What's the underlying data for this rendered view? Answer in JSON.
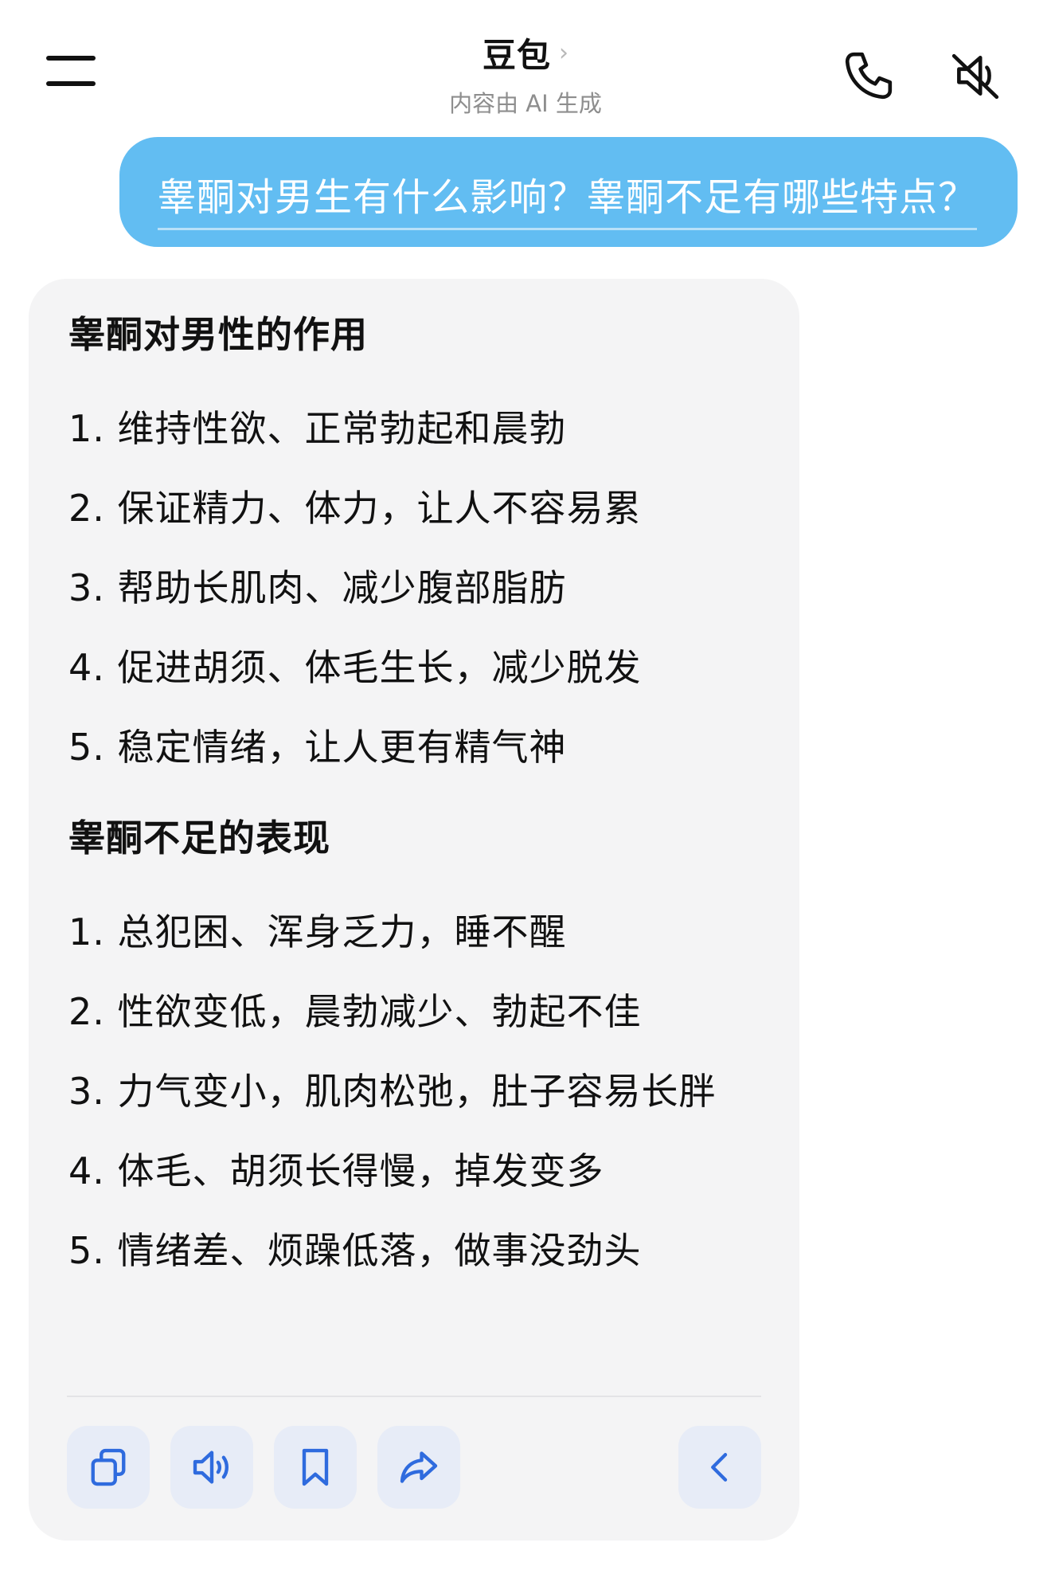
{
  "header": {
    "title": "豆包",
    "title_chevron": "›",
    "subtitle": "内容由 AI 生成"
  },
  "user_message": {
    "text": "睾酮对男生有什么影响？睾酮不足有哪些特点？"
  },
  "answer": {
    "section1": {
      "heading": "睾酮对男性的作用",
      "items": [
        "1. 维持性欲、正常勃起和晨勃",
        "2. 保证精力、体力，让人不容易累",
        "3. 帮助长肌肉、减少腹部脂肪",
        "4. 促进胡须、体毛生长，减少脱发",
        "5. 稳定情绪，让人更有精气神"
      ]
    },
    "section2": {
      "heading": "睾酮不足的表现",
      "items": [
        "1. 总犯困、浑身乏力，睡不醒",
        "2. 性欲变低，晨勃减少、勃起不佳",
        "3. 力气变小，肌肉松弛，肚子容易长胖",
        "4. 体毛、胡须长得慢，掉发变多",
        "5. 情绪差、烦躁低落，做事没劲头"
      ]
    }
  },
  "icons": {
    "menu": "menu-icon",
    "phone": "phone-icon",
    "mute": "speaker-mute-icon",
    "copy": "copy-icon",
    "read_aloud": "speaker-icon",
    "bookmark": "bookmark-icon",
    "share": "share-icon",
    "collapse": "chevron-left-icon"
  },
  "colors": {
    "user_bubble": "#62bdf2",
    "card_background": "#f4f4f5",
    "action_button": "#e7ecf7",
    "action_icon": "#2f6bde"
  }
}
